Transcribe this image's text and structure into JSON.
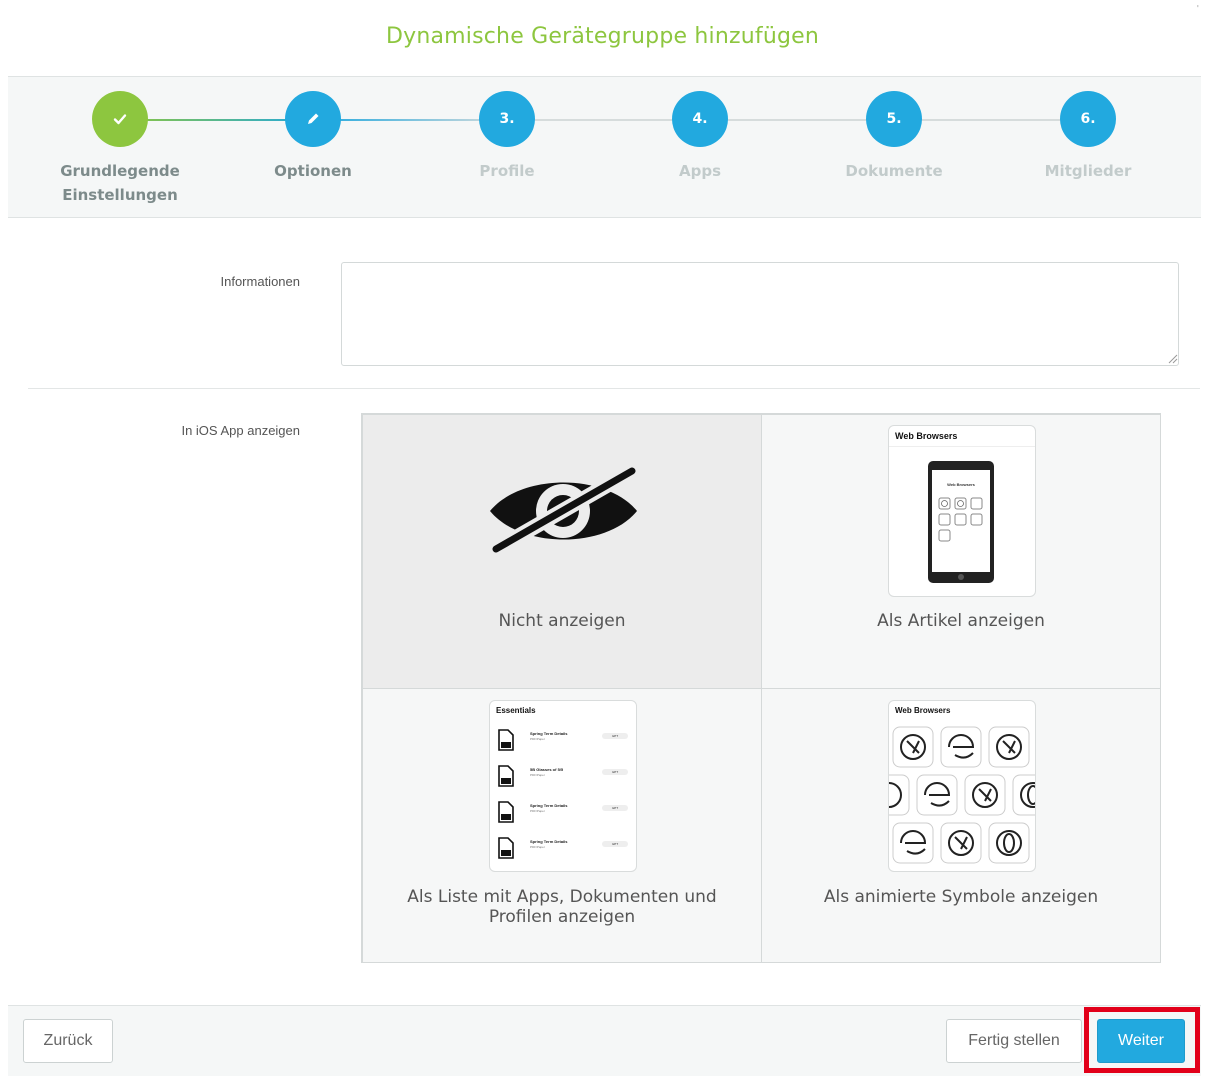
{
  "page": {
    "title": "Dynamische Gerätegruppe hinzufügen",
    "corner_mark": "'"
  },
  "wizard": {
    "steps": [
      {
        "badge": "✓",
        "label": "Grundlegende Einstellungen",
        "state": "done"
      },
      {
        "badge": "✎",
        "label": "Optionen",
        "state": "current"
      },
      {
        "badge": "3.",
        "label": "Profile",
        "state": "pending"
      },
      {
        "badge": "4.",
        "label": "Apps",
        "state": "pending"
      },
      {
        "badge": "5.",
        "label": "Dokumente",
        "state": "pending"
      },
      {
        "badge": "6.",
        "label": "Mitglieder",
        "state": "pending"
      }
    ],
    "colors": {
      "done": "#8dc63f",
      "active": "#22a9df",
      "inactive_text": "#c2cbcb"
    }
  },
  "form": {
    "info_label": "Informationen",
    "info_value": "",
    "ios_label": "In iOS App anzeigen"
  },
  "display_options": {
    "selected": "hidden",
    "options": [
      {
        "id": "hidden",
        "label": "Nicht anzeigen",
        "icon": "eye-slash-icon"
      },
      {
        "id": "article",
        "label": "Als Artikel anzeigen",
        "preview_title": "Web Browsers",
        "phone_title": "Web Browsers"
      },
      {
        "id": "list",
        "label": "Als Liste mit Apps, Dokumenten und Profilen anzeigen",
        "preview_title": "Essentials",
        "items": [
          {
            "name": "Spring Term Details",
            "sub": "PDF/Paper",
            "action": "GET"
          },
          {
            "name": "5B Glasses of 5/5",
            "sub": "PDF/Paper",
            "action": "GET"
          },
          {
            "name": "Spring Term Details",
            "sub": "PDF/Paper",
            "action": "GET"
          },
          {
            "name": "Spring Term Details",
            "sub": "PDF/Paper",
            "action": "GET"
          }
        ]
      },
      {
        "id": "animated",
        "label": "Als animierte Symbole anzeigen",
        "preview_title": "Web Browsers"
      }
    ]
  },
  "footer": {
    "back": "Zurück",
    "finish": "Fertig stellen",
    "next": "Weiter"
  }
}
